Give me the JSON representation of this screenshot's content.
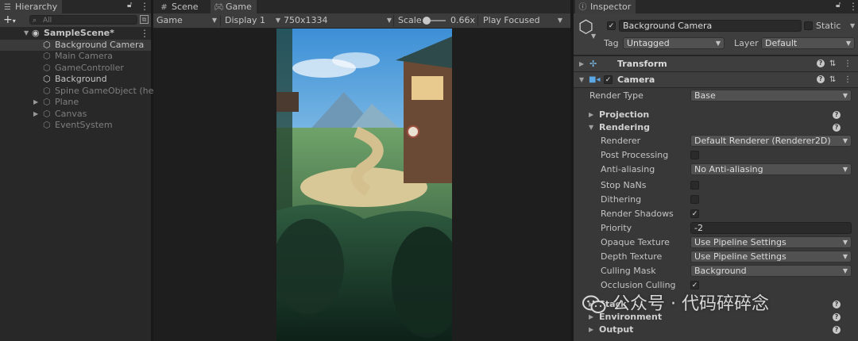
{
  "hierarchy": {
    "tab_label": "Hierarchy",
    "search_placeholder": "All",
    "items": [
      {
        "label": "SampleScene*",
        "icon": "unity-scene-icon"
      },
      {
        "label": "Background Camera",
        "icon": "gameobject-cube-icon",
        "selected": true
      },
      {
        "label": "Main Camera",
        "icon": "gameobject-cube-icon",
        "dim": true
      },
      {
        "label": "GameController",
        "icon": "gameobject-cube-icon",
        "dim": true
      },
      {
        "label": "Background",
        "icon": "gameobject-cube-icon"
      },
      {
        "label": "Spine GameObject (hero",
        "icon": "gameobject-cube-icon",
        "dim": true
      },
      {
        "label": "Plane",
        "icon": "gameobject-cube-icon",
        "dim": true,
        "collapsed": true
      },
      {
        "label": "Canvas",
        "icon": "gameobject-cube-icon",
        "dim": true,
        "collapsed": true
      },
      {
        "label": "EventSystem",
        "icon": "gameobject-cube-icon",
        "dim": true
      }
    ]
  },
  "game": {
    "tabs": [
      {
        "label": "Scene",
        "icon": "grid-icon"
      },
      {
        "label": "Game",
        "icon": "gamepad-icon"
      }
    ],
    "toolbar": {
      "view_mode": "Game",
      "display": "Display 1",
      "resolution": "750x1334",
      "scale_label": "Scale",
      "scale_value": "0.66x",
      "play_mode": "Play Focused"
    }
  },
  "inspector": {
    "tab_label": "Inspector",
    "object_name": "Background Camera",
    "static_label": "Static",
    "tag_label": "Tag",
    "tag_value": "Untagged",
    "layer_label": "Layer",
    "layer_value": "Default",
    "transform_title": "Transform",
    "camera_title": "Camera",
    "render_type_label": "Render Type",
    "render_type_value": "Base",
    "sections": {
      "projection": "Projection",
      "rendering": "Rendering",
      "stack": "Stack",
      "environment": "Environment",
      "output": "Output"
    },
    "rendering": {
      "renderer_label": "Renderer",
      "renderer_value": "Default Renderer (Renderer2D)",
      "post_processing_label": "Post Processing",
      "post_processing": false,
      "anti_aliasing_label": "Anti-aliasing",
      "anti_aliasing_value": "No Anti-aliasing",
      "stop_nans_label": "Stop NaNs",
      "stop_nans": false,
      "dithering_label": "Dithering",
      "dithering": false,
      "render_shadows_label": "Render Shadows",
      "render_shadows": true,
      "priority_label": "Priority",
      "priority_value": "-2",
      "opaque_texture_label": "Opaque Texture",
      "opaque_texture_value": "Use Pipeline Settings",
      "depth_texture_label": "Depth Texture",
      "depth_texture_value": "Use Pipeline Settings",
      "culling_mask_label": "Culling Mask",
      "culling_mask_value": "Background",
      "occlusion_culling_label": "Occlusion Culling",
      "occlusion_culling": true
    }
  },
  "watermark": {
    "text": "公众号 · 代码碎碎念"
  }
}
